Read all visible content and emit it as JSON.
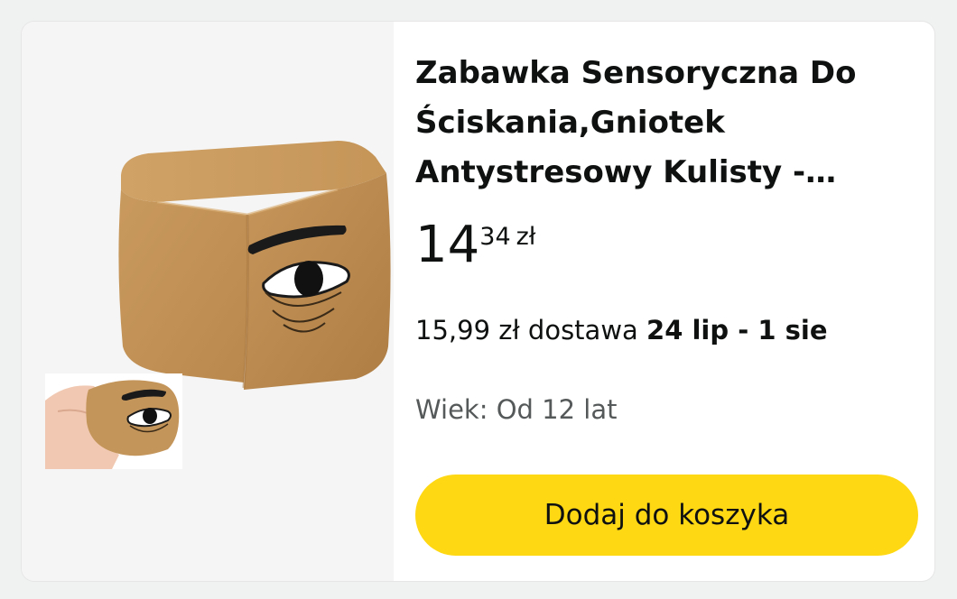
{
  "product": {
    "title_lines": [
      "Zabawka Sensoryczna Do",
      "Ściskania,Gniotek",
      "Antystresowy Kulisty -…"
    ],
    "price": {
      "whole": "14",
      "fraction": "34",
      "currency": "zł"
    },
    "delivery": {
      "prefix": "15,99 zł dostawa ",
      "dates": "24 lip - 1 sie"
    },
    "age": "Wiek: Od 12 lat",
    "add_to_cart_label": "Dodaj do koszyka"
  },
  "colors": {
    "button_yellow": "#ffd814",
    "text_primary": "#0f1111",
    "text_secondary": "#565959",
    "image_background": "#f5f5f5",
    "cube_tan": "#c4955a"
  }
}
